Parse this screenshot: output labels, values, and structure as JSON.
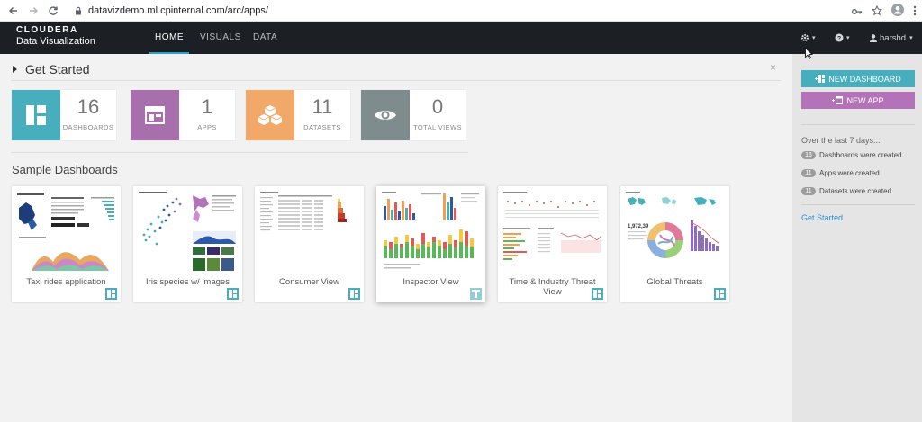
{
  "browser": {
    "url": "datavizdemo.ml.cpinternal.com/arc/apps/"
  },
  "app": {
    "logo_top": "CLOUDERA",
    "logo_bottom": "Data Visualization",
    "nav": [
      "HOME",
      "VISUALS",
      "DATA"
    ],
    "active_nav": "HOME",
    "user": "harshd"
  },
  "get_started": {
    "title": "Get Started",
    "close": "×"
  },
  "stats": [
    {
      "number": "16",
      "label": "DASHBOARDS",
      "color": "#47aebd",
      "icon": "dashboard-icon"
    },
    {
      "number": "1",
      "label": "APPS",
      "color": "#a86fad",
      "icon": "app-icon"
    },
    {
      "number": "11",
      "label": "DATASETS",
      "color": "#f2a868",
      "icon": "cubes-icon"
    },
    {
      "number": "0",
      "label": "TOTAL VIEWS",
      "color": "#7f8c8d",
      "icon": "eye-icon"
    }
  ],
  "sample": {
    "title": "Sample Dashboards",
    "cards": [
      {
        "label": "Taxi rides application"
      },
      {
        "label": "Iris species w/ images"
      },
      {
        "label": "Consumer View"
      },
      {
        "label": "Inspector View"
      },
      {
        "label": "Time & Industry Threat View"
      },
      {
        "label": "Global Threats"
      }
    ]
  },
  "sidebar": {
    "new_dashboard": "NEW DASHBOARD",
    "new_app": "NEW APP",
    "subtitle": "Over the last 7 days...",
    "rows": [
      {
        "count": "16",
        "text": "Dashboards were created"
      },
      {
        "count": "11",
        "text": "Apps were created"
      },
      {
        "count": "11",
        "text": "Datasets were created"
      }
    ],
    "link": "Get Started"
  },
  "colors": {
    "accent_teal": "#47aebd",
    "accent_purple": "#b473b8",
    "header_bg": "#1c2024"
  }
}
